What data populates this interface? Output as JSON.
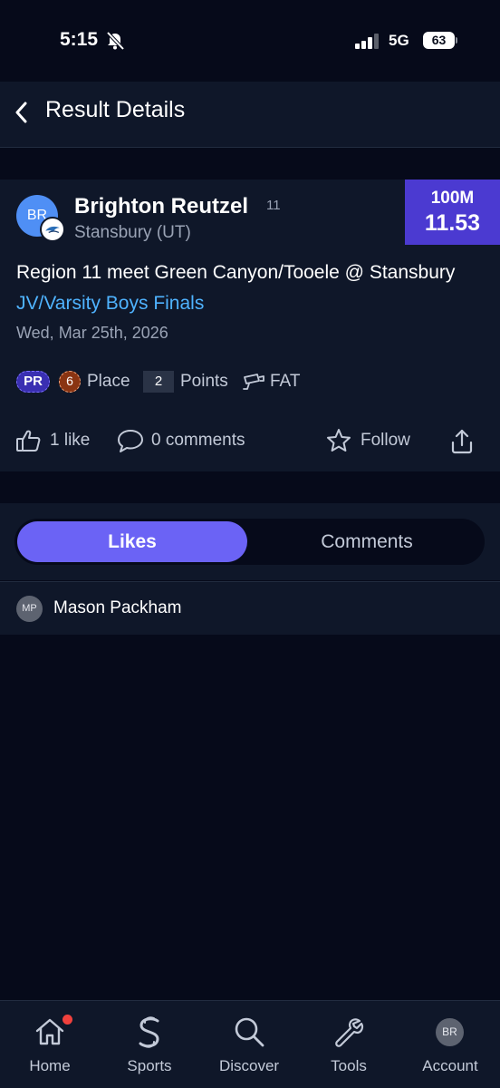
{
  "status_bar": {
    "time": "5:15",
    "network": "5G",
    "battery": "63"
  },
  "header": {
    "title": "Result Details"
  },
  "result": {
    "avatar_initials": "BR",
    "athlete_name": "Brighton Reutzel",
    "grade": "11",
    "school": "Stansbury (UT)",
    "event": "100M",
    "mark": "11.53",
    "meet_name": "Region 11 meet Green Canyon/Tooele @ Stansbury",
    "division": "JV/Varsity Boys Finals",
    "date": "Wed, Mar 25th, 2026",
    "badges": {
      "pr": "PR",
      "place_number": "6",
      "place_label": "Place",
      "points_number": "2",
      "points_label": "Points",
      "timing": "FAT"
    },
    "actions": {
      "likes": "1 like",
      "comments": "0 comments",
      "follow": "Follow"
    }
  },
  "tabs": [
    {
      "label": "Likes",
      "active": true
    },
    {
      "label": "Comments",
      "active": false
    }
  ],
  "likes": [
    {
      "initials": "MP",
      "name": "Mason Packham"
    }
  ],
  "nav": {
    "items": [
      {
        "label": "Home",
        "icon": "home-icon",
        "notification": true
      },
      {
        "label": "Sports",
        "icon": "sports-icon"
      },
      {
        "label": "Discover",
        "icon": "search-icon"
      },
      {
        "label": "Tools",
        "icon": "wrench-icon"
      },
      {
        "label": "Account",
        "icon": "avatar",
        "initials": "BR"
      }
    ]
  },
  "colors": {
    "background": "#060a1a",
    "card": "#0f1729",
    "accent": "#6b63f5",
    "mark_box": "#4b3ad1",
    "link": "#4fb3ff",
    "notification": "#f0413d"
  }
}
